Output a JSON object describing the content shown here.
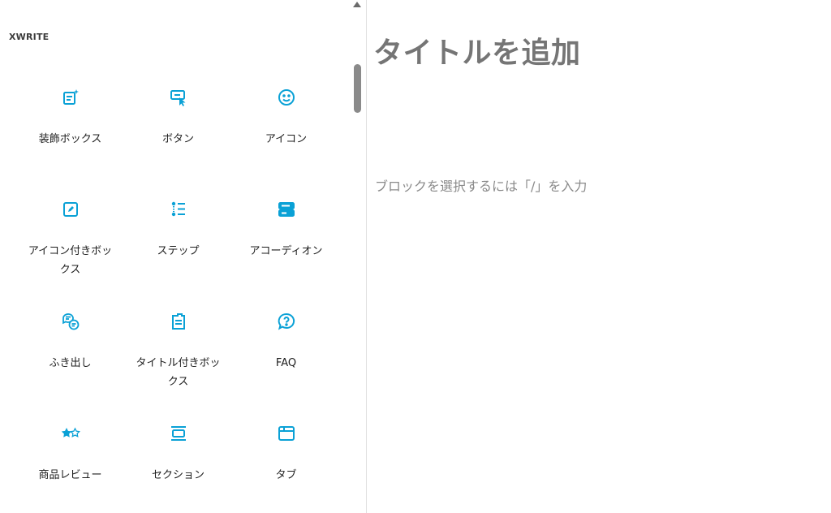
{
  "inserter": {
    "category": "XWRITE",
    "blocks": [
      {
        "label": "装飾ボックス",
        "icon": "decorated-box-icon"
      },
      {
        "label": "ボタン",
        "icon": "button-icon"
      },
      {
        "label": "アイコン",
        "icon": "smiley-icon"
      },
      {
        "label": "アイコン付きボックス",
        "icon": "icon-box-icon"
      },
      {
        "label": "ステップ",
        "icon": "steps-icon"
      },
      {
        "label": "アコーディオン",
        "icon": "accordion-icon"
      },
      {
        "label": "ふき出し",
        "icon": "speech-bubble-icon"
      },
      {
        "label": "タイトル付きボックス",
        "icon": "titled-box-icon"
      },
      {
        "label": "FAQ",
        "icon": "faq-icon"
      },
      {
        "label": "商品レビュー",
        "icon": "review-stars-icon"
      },
      {
        "label": "セクション",
        "icon": "section-icon"
      },
      {
        "label": "タブ",
        "icon": "tabs-icon"
      }
    ]
  },
  "editor": {
    "title_placeholder": "タイトルを追加",
    "block_placeholder": "ブロックを選択するには「/」を入力"
  },
  "colors": {
    "accent": "#0aa1d6",
    "title": "#757575",
    "placeholder": "#8a8a8a"
  }
}
